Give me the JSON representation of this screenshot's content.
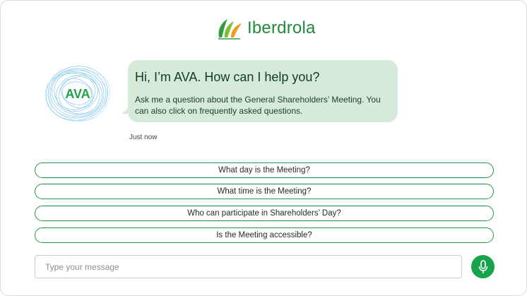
{
  "brand": {
    "name": "Iberdrola",
    "color": "#1f8a3b",
    "logo_icon": "iberdrola-leaf-logo-icon"
  },
  "assistant": {
    "avatar_text": "AVA",
    "greeting": "Hi, I’m AVA. How can I help you?",
    "intro": "Ask me a question about the General Shareholders’ Meeting. You can also click on frequently asked questions.",
    "timestamp": "Just now",
    "bubble_color": "#d6ead9"
  },
  "faq": [
    {
      "label": "What day is the Meeting?"
    },
    {
      "label": "What time is the Meeting?"
    },
    {
      "label": "Who can participate in Shareholders’ Day?"
    },
    {
      "label": "Is the Meeting accessible?"
    }
  ],
  "composer": {
    "placeholder": "Type your message",
    "value": "",
    "mic_icon": "microphone-icon",
    "accent": "#16a34a"
  }
}
